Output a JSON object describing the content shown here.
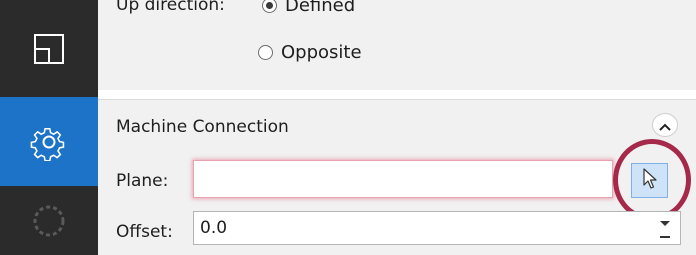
{
  "up_direction": {
    "label": "Up direction:",
    "options": [
      {
        "label": "Defined",
        "selected": true
      },
      {
        "label": "Opposite",
        "selected": false
      }
    ]
  },
  "machine_connection": {
    "title": "Machine Connection",
    "plane_label": "Plane:",
    "plane_value": "",
    "offset_label": "Offset:",
    "offset_value": "0.0"
  },
  "sidebar": {
    "items": [
      {
        "icon": "layout-icon",
        "active": false
      },
      {
        "icon": "gear-icon",
        "active": true
      },
      {
        "icon": "dashed-circle-icon",
        "active": false
      }
    ]
  },
  "colors": {
    "rail": "#2b2b2b",
    "rail_active": "#1c73c8",
    "panel": "#f1f1f1",
    "error_border": "#e7a3ae",
    "annotation_ring": "#a52a4a"
  }
}
